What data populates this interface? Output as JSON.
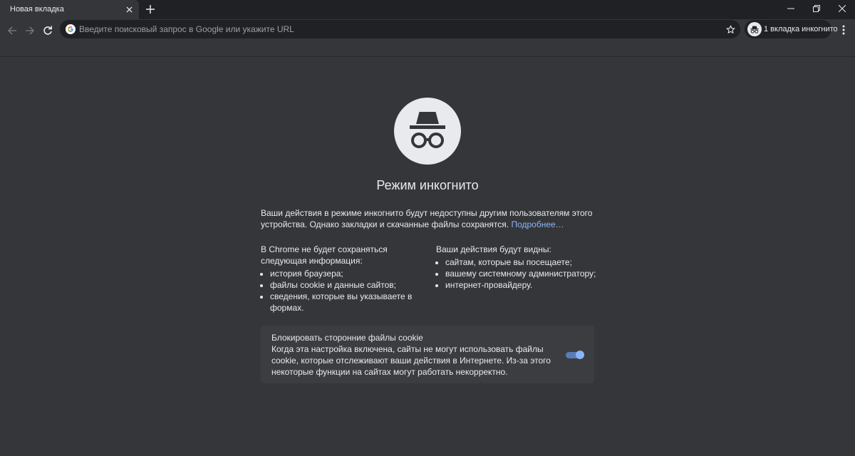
{
  "tab": {
    "title": "Новая вкладка"
  },
  "omnibox": {
    "placeholder": "Введите поисковый запрос в Google или укажите URL"
  },
  "profile": {
    "label": "1 вкладка инкогнито"
  },
  "main": {
    "heading": "Режим инкогнито",
    "intro_text": "Ваши действия в режиме инкогнито будут недоступны другим пользователям этого устройства. Однако закладки и скачанные файлы сохранятся.",
    "learn_more": "Подробнее…",
    "not_saved": {
      "title": "В Chrome не будет сохраняться следующая информация:",
      "items": [
        "история браузера;",
        "файлы cookie и данные сайтов;",
        "сведения, которые вы указываете в формах."
      ]
    },
    "visible_to": {
      "title": "Ваши действия будут видны:",
      "items": [
        "сайтам, которые вы посещаете;",
        "вашему системному администратору;",
        "интернет-провайдеру."
      ]
    },
    "cookie_card": {
      "title": "Блокировать сторонние файлы cookie",
      "description": "Когда эта настройка включена, сайты не могут использовать файлы cookie, которые отслеживают ваши действия в Интернете. Из-за этого некоторые функции на сайтах могут работать некорректно.",
      "enabled": true
    }
  },
  "colors": {
    "background": "#35363a",
    "tabstrip": "#202124",
    "link": "#8ab4f8",
    "toggle_on": "#8ab4f8"
  }
}
